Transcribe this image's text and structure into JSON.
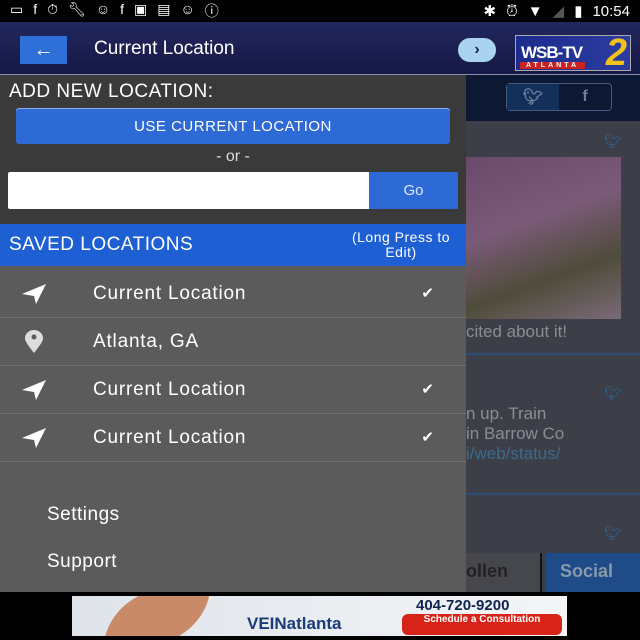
{
  "status_bar": {
    "left_icons": [
      "messages-icon",
      "facebook-icon",
      "stopwatch-icon",
      "wrench-icon",
      "smiley-icon",
      "facebook-icon",
      "qt-icon",
      "app-icon",
      "smiley-icon",
      "info-icon"
    ],
    "time": "10:54"
  },
  "header": {
    "title": "Current Location",
    "logo": "WSB-TV 2 ATLANTA"
  },
  "drawer": {
    "add_title": "ADD NEW LOCATION:",
    "use_current_label": "USE CURRENT LOCATION",
    "or_label": "- or -",
    "search_value": "",
    "go_label": "Go",
    "saved_title": "SAVED LOCATIONS",
    "saved_hint": "(Long Press to Edit)",
    "locations": [
      {
        "label": "Current Location",
        "icon": "navigation-arrow-icon",
        "checked": true
      },
      {
        "label": "Atlanta, GA",
        "icon": "map-pin-icon",
        "checked": false
      },
      {
        "label": "Current Location",
        "icon": "navigation-arrow-icon",
        "checked": true
      },
      {
        "label": "Current Location",
        "icon": "navigation-arrow-icon",
        "checked": true
      }
    ],
    "menu": {
      "settings": "Settings",
      "support": "Support"
    }
  },
  "background": {
    "post1": "cited about it!",
    "post2_line1": "n up. Train",
    "post2_line2": "in Barrow Co",
    "post2_line3": "i/web/status/",
    "tab_left": "ollen",
    "tab_social": "Social"
  },
  "ad": {
    "brand": "VEINatlanta",
    "phone": "404-720-9200",
    "cta": "Schedule a Consultation"
  }
}
